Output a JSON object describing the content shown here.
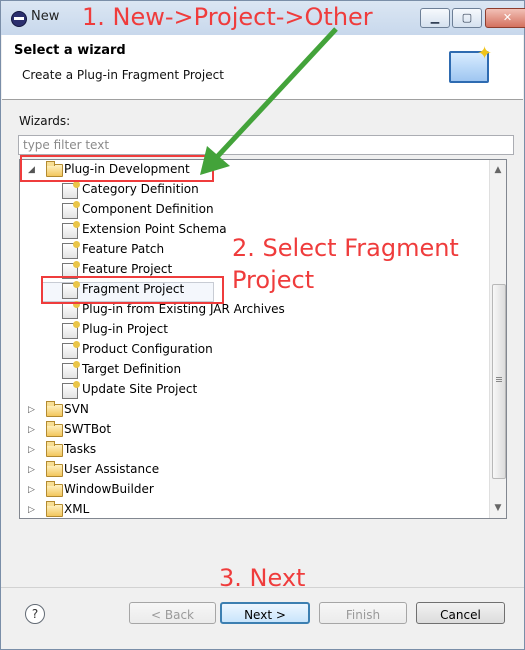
{
  "window": {
    "title": "New",
    "controls": [
      "minimize",
      "maximize",
      "close"
    ]
  },
  "header": {
    "title": "Select a wizard",
    "description": "Create a Plug-in Fragment Project"
  },
  "wizards": {
    "label": "Wizards:",
    "filter_placeholder": "type filter text"
  },
  "tree": {
    "items": [
      {
        "label": "Plug-in Development",
        "icon": "folder-icon",
        "expanded": true
      },
      {
        "label": "Category Definition",
        "icon": "category-definition-icon"
      },
      {
        "label": "Component Definition",
        "icon": "component-definition-icon"
      },
      {
        "label": "Extension Point Schema",
        "icon": "extension-point-schema-icon"
      },
      {
        "label": "Feature Patch",
        "icon": "feature-patch-icon"
      },
      {
        "label": "Feature Project",
        "icon": "feature-project-icon"
      },
      {
        "label": "Fragment Project",
        "icon": "fragment-project-icon",
        "selected": true
      },
      {
        "label": "Plug-in from Existing JAR Archives",
        "icon": "plugin-jar-icon"
      },
      {
        "label": "Plug-in Project",
        "icon": "plugin-project-icon"
      },
      {
        "label": "Product Configuration",
        "icon": "product-configuration-icon"
      },
      {
        "label": "Target Definition",
        "icon": "target-definition-icon"
      },
      {
        "label": "Update Site Project",
        "icon": "update-site-icon"
      },
      {
        "label": "SVN",
        "icon": "folder-icon",
        "expanded": false
      },
      {
        "label": "SWTBot",
        "icon": "folder-icon",
        "expanded": false
      },
      {
        "label": "Tasks",
        "icon": "folder-icon",
        "expanded": false
      },
      {
        "label": "User Assistance",
        "icon": "folder-icon",
        "expanded": false
      },
      {
        "label": "WindowBuilder",
        "icon": "folder-icon",
        "expanded": false
      },
      {
        "label": "XML",
        "icon": "folder-icon",
        "expanded": false
      }
    ]
  },
  "buttons": {
    "help": "?",
    "back": "< Back",
    "next": "Next >",
    "finish": "Finish",
    "cancel": "Cancel"
  },
  "annotations": {
    "step1": "1. New->Project->Other",
    "step2_line1": "2. Select Fragment",
    "step2_line2": "Project",
    "step3": "3. Next"
  },
  "colors": {
    "annotation": "#ef3c3c",
    "arrow": "#43a33a",
    "selection": "#f4f7fc"
  }
}
